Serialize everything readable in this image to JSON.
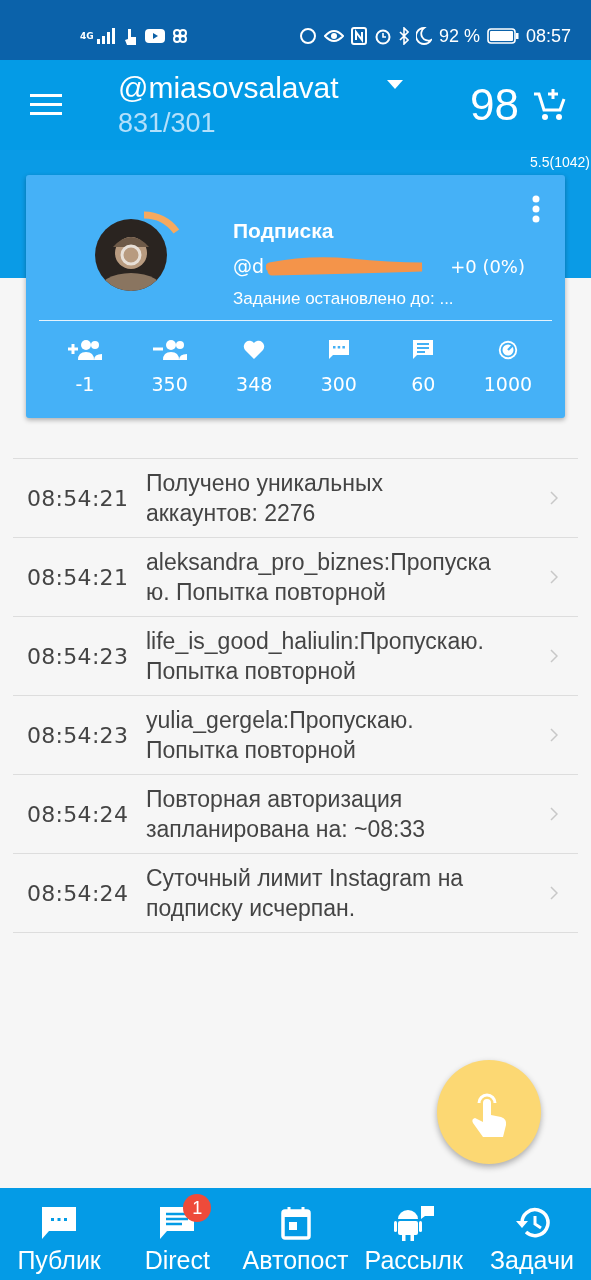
{
  "status_bar": {
    "network": "4G",
    "battery": "92 %",
    "time": "08:57"
  },
  "app_bar": {
    "account": "@miasovsalavat",
    "counts": "831/301",
    "balance": "98"
  },
  "version": "5.5(1042)",
  "task_card": {
    "title": "Подписка",
    "handle": "@d",
    "delta": "+0 (0%)",
    "status": "Задание остановлено до: ...",
    "stats": [
      {
        "kind": "follow",
        "value": "-1"
      },
      {
        "kind": "unfollow",
        "value": "350"
      },
      {
        "kind": "like",
        "value": "348"
      },
      {
        "kind": "comment",
        "value": "300"
      },
      {
        "kind": "message",
        "value": "60"
      },
      {
        "kind": "limit",
        "value": "1000"
      }
    ]
  },
  "log": [
    {
      "time": "08:54:21",
      "message": "Получено уникальных аккаунтов: 2276"
    },
    {
      "time": "08:54:21",
      "message": "aleksandra_pro_biznes:Пропускаю. Попытка повторной"
    },
    {
      "time": "08:54:23",
      "message": "life_is_good_haliulin:Пропускаю. Попытка повторной"
    },
    {
      "time": "08:54:23",
      "message": "yulia_gergela:Пропускаю. Попытка повторной"
    },
    {
      "time": "08:54:24",
      "message": "Повторная авторизация запланирована на: ~08:33"
    },
    {
      "time": "08:54:24",
      "message": "Суточный лимит Instagram на подписку исчерпан."
    }
  ],
  "bottom_nav": [
    {
      "kind": "public",
      "label": "Публик"
    },
    {
      "kind": "direct",
      "label": "Direct",
      "badge": "1"
    },
    {
      "kind": "autopost",
      "label": "Автопост"
    },
    {
      "kind": "mailing",
      "label": "Рассылк"
    },
    {
      "kind": "tasks",
      "label": "Задачи"
    }
  ]
}
